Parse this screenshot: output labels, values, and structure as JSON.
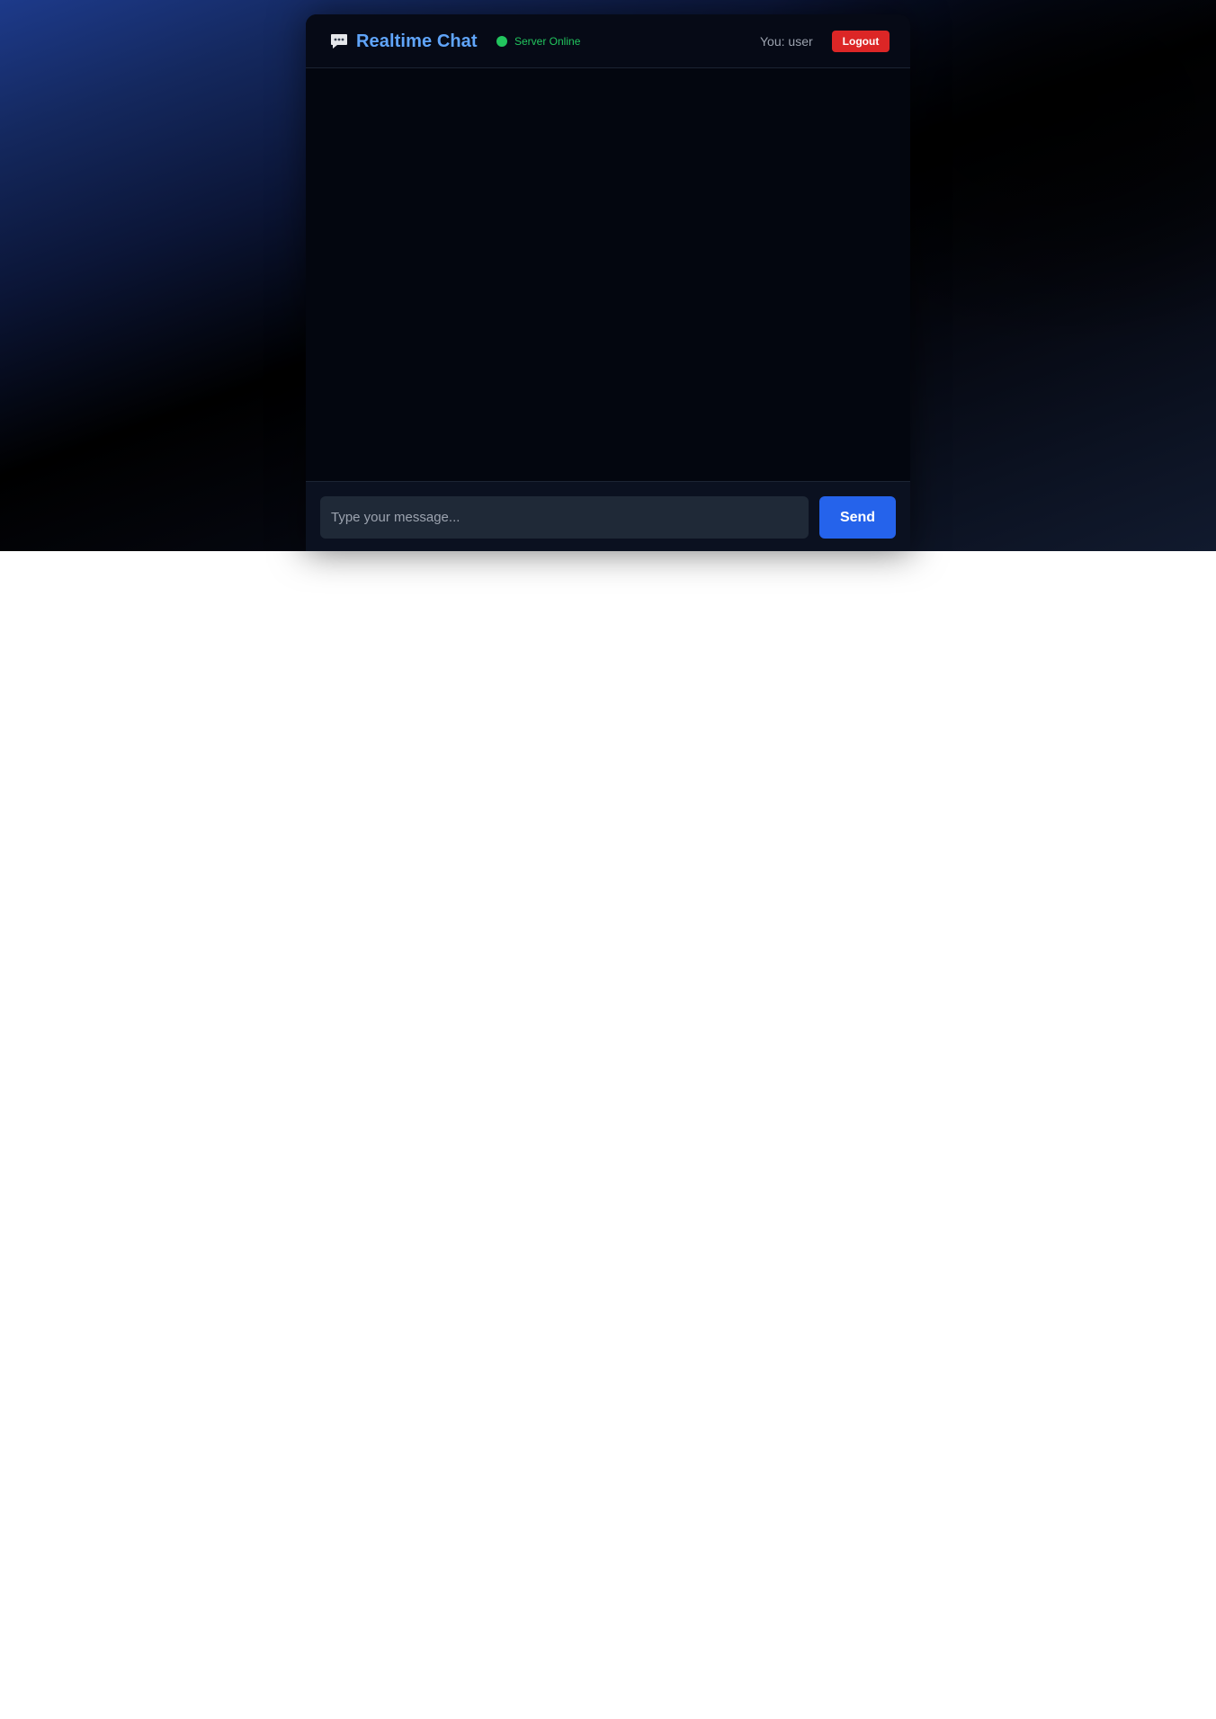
{
  "header": {
    "title": "Realtime Chat",
    "icon": "chat-bubble-icon",
    "status_text": "Server Online",
    "status_color": "#22c55e",
    "user_label": "You: user",
    "logout_label": "Logout"
  },
  "messages": [],
  "composer": {
    "placeholder": "Type your message...",
    "value": "",
    "send_label": "Send"
  },
  "colors": {
    "accent": "#2563eb",
    "title": "#60a5fa",
    "danger": "#dc2626"
  }
}
